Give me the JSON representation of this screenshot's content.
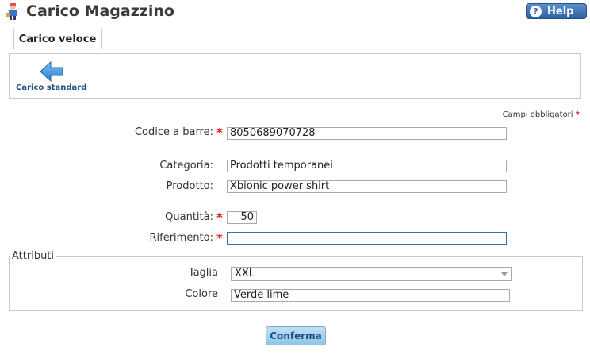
{
  "header": {
    "title": "Carico Magazzino",
    "help_label": "Help",
    "help_icon": "question-mark"
  },
  "tabs": [
    {
      "label": "Carico veloce",
      "active": true
    }
  ],
  "toolbar": {
    "back_label": "Carico standard",
    "back_icon": "left-arrow"
  },
  "required_note": "Campi obbligatori",
  "form": {
    "barcode": {
      "label": "Codice a barre:",
      "value": "8050689070728",
      "required": true
    },
    "category": {
      "label": "Categoria:",
      "value": "Prodotti temporanei"
    },
    "product": {
      "label": "Prodotto:",
      "value": "Xbionic power shirt"
    },
    "quantity": {
      "label": "Quantità:",
      "value": "50",
      "required": true
    },
    "reference": {
      "label": "Riferimento:",
      "value": "",
      "required": true
    }
  },
  "attributes": {
    "legend": "Attributi",
    "size": {
      "label": "Taglia",
      "value": "XXL"
    },
    "color": {
      "label": "Colore",
      "value": "Verde lime"
    }
  },
  "actions": {
    "confirm_label": "Conferma"
  },
  "colors": {
    "accent": "#2d62a3",
    "required_star": "#e0141e",
    "confirm_bg": "#a6d2f0"
  }
}
